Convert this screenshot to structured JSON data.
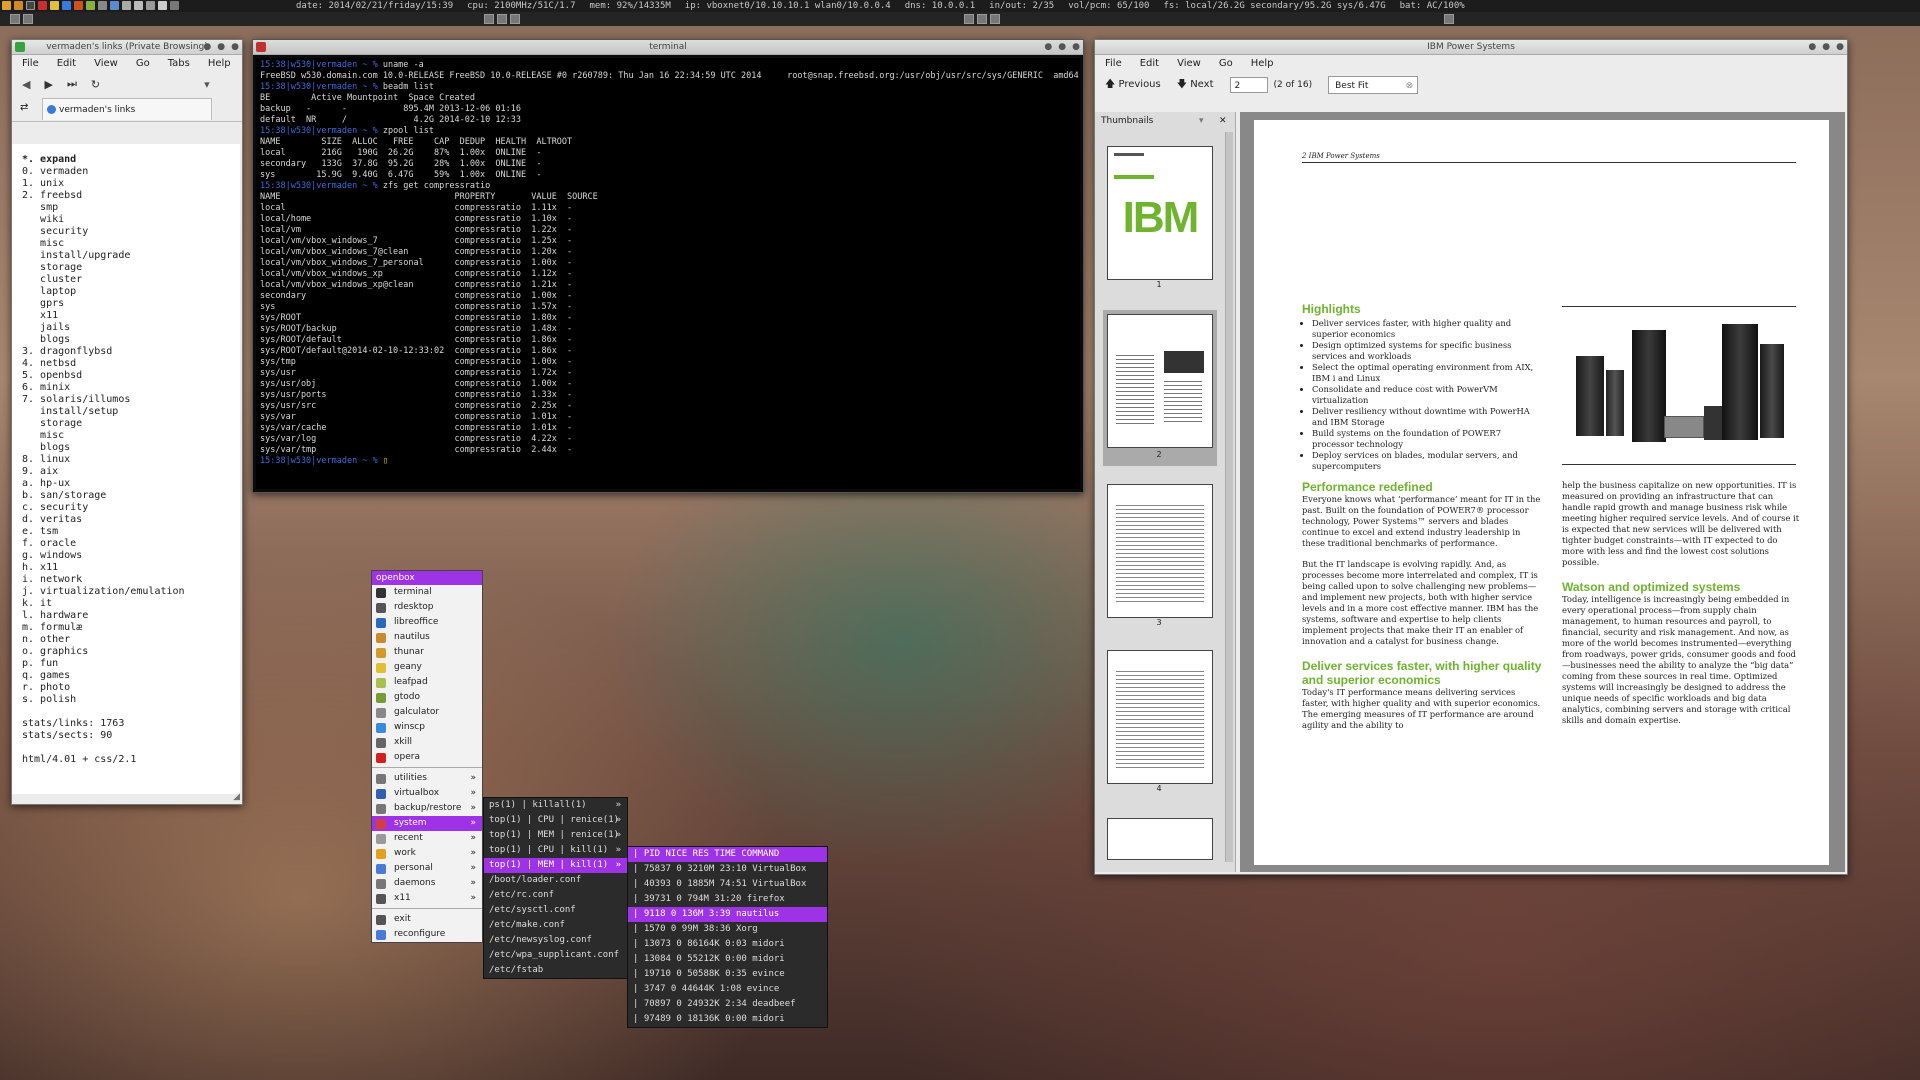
{
  "topbar": {
    "date": "date: 2014/02/21/friday/15:39",
    "cpu": "cpu: 2100MHz/51C/1.7",
    "mem": "mem: 92%/14335M",
    "ip": "ip: vboxnet0/10.10.10.1 wlan0/10.0.0.4",
    "dns": "dns: 10.0.0.1",
    "inout": "in/out: 2/35",
    "vol": "vol/pcm: 65/100",
    "fs": "fs: local/26.2G secondary/95.2G sys/6.47G",
    "bat": "bat: AC/100%"
  },
  "links_window": {
    "title": "vermaden's links (Private Browsing)",
    "menu": [
      "File",
      "Edit",
      "View",
      "Go",
      "Tabs",
      "Help"
    ],
    "tab_label": "vermaden's links",
    "lines": [
      "*. expand",
      "0. vermaden",
      "1. unix",
      "2. freebsd",
      "   smp",
      "   wiki",
      "   security",
      "   misc",
      "   install/upgrade",
      "   storage",
      "   cluster",
      "   laptop",
      "   gprs",
      "   x11",
      "   jails",
      "   blogs",
      "3. dragonflybsd",
      "4. netbsd",
      "5. openbsd",
      "6. minix",
      "7. solaris/illumos",
      "   install/setup",
      "   storage",
      "   misc",
      "   blogs",
      "8. linux",
      "9. aix",
      "a. hp-ux",
      "b. san/storage",
      "c. security",
      "d. veritas",
      "e. tsm",
      "f. oracle",
      "g. windows",
      "h. x11",
      "i. network",
      "j. virtualization/emulation",
      "k. it",
      "l. hardware",
      "m. formulæ",
      "n. other",
      "o. graphics",
      "p. fun",
      "q. games",
      "r. photo",
      "s. polish",
      "",
      "stats/links: 1763",
      "stats/sects: 90",
      "",
      "html/4.01 + css/2.1"
    ]
  },
  "terminal": {
    "title": "terminal",
    "lines": [
      {
        "p": "15:38|w530|vermaden ~ % ",
        "t": "uname -a"
      },
      {
        "p": "",
        "t": "FreeBSD w530.domain.com 10.0-RELEASE FreeBSD 10.0-RELEASE #0 r260789: Thu Jan 16 22:34:59 UTC 2014     root@snap.freebsd.org:/usr/obj/usr/src/sys/GENERIC  amd64"
      },
      {
        "p": "15:38|w530|vermaden ~ % ",
        "t": "beadm list"
      },
      {
        "p": "",
        "t": "BE        Active Mountpoint  Space Created"
      },
      {
        "p": "",
        "t": "backup   -      -           895.4M 2013-12-06 01:16"
      },
      {
        "p": "",
        "t": "default  NR     /             4.2G 2014-02-10 12:33"
      },
      {
        "p": "15:38|w530|vermaden ~ % ",
        "t": "zpool list"
      },
      {
        "p": "",
        "t": "NAME        SIZE  ALLOC   FREE    CAP  DEDUP  HEALTH  ALTROOT"
      },
      {
        "p": "",
        "t": "local       216G   190G  26.2G    87%  1.00x  ONLINE  -"
      },
      {
        "p": "",
        "t": "secondary   133G  37.8G  95.2G    28%  1.00x  ONLINE  -"
      },
      {
        "p": "",
        "t": "sys        15.9G  9.40G  6.47G    59%  1.00x  ONLINE  -"
      },
      {
        "p": "15:38|w530|vermaden ~ % ",
        "t": "zfs get compressratio"
      },
      {
        "p": "",
        "t": "NAME                                  PROPERTY       VALUE  SOURCE"
      },
      {
        "p": "",
        "t": "local                                 compressratio  1.11x  -"
      },
      {
        "p": "",
        "t": "local/home                            compressratio  1.10x  -"
      },
      {
        "p": "",
        "t": "local/vm                              compressratio  1.22x  -"
      },
      {
        "p": "",
        "t": "local/vm/vbox_windows_7               compressratio  1.25x  -"
      },
      {
        "p": "",
        "t": "local/vm/vbox_windows_7@clean         compressratio  1.20x  -"
      },
      {
        "p": "",
        "t": "local/vm/vbox_windows_7_personal      compressratio  1.00x  -"
      },
      {
        "p": "",
        "t": "local/vm/vbox_windows_xp              compressratio  1.12x  -"
      },
      {
        "p": "",
        "t": "local/vm/vbox_windows_xp@clean        compressratio  1.21x  -"
      },
      {
        "p": "",
        "t": "secondary                             compressratio  1.00x  -"
      },
      {
        "p": "",
        "t": "sys                                   compressratio  1.57x  -"
      },
      {
        "p": "",
        "t": "sys/ROOT                              compressratio  1.80x  -"
      },
      {
        "p": "",
        "t": "sys/ROOT/backup                       compressratio  1.48x  -"
      },
      {
        "p": "",
        "t": "sys/ROOT/default                      compressratio  1.86x  -"
      },
      {
        "p": "",
        "t": "sys/ROOT/default@2014-02-10-12:33:02  compressratio  1.86x  -"
      },
      {
        "p": "",
        "t": "sys/tmp                               compressratio  1.00x  -"
      },
      {
        "p": "",
        "t": "sys/usr                               compressratio  1.72x  -"
      },
      {
        "p": "",
        "t": "sys/usr/obj                           compressratio  1.00x  -"
      },
      {
        "p": "",
        "t": "sys/usr/ports                         compressratio  1.33x  -"
      },
      {
        "p": "",
        "t": "sys/usr/src                           compressratio  2.25x  -"
      },
      {
        "p": "",
        "t": "sys/var                               compressratio  1.01x  -"
      },
      {
        "p": "",
        "t": "sys/var/cache                         compressratio  1.01x  -"
      },
      {
        "p": "",
        "t": "sys/var/log                           compressratio  4.22x  -"
      },
      {
        "p": "",
        "t": "sys/var/tmp                           compressratio  2.44x  -"
      },
      {
        "p": "15:38|w530|vermaden ~ % ",
        "t": "▯"
      }
    ]
  },
  "pdf_window": {
    "title": "IBM Power Systems",
    "menu": [
      "File",
      "Edit",
      "View",
      "Go",
      "Help"
    ],
    "prev_label": "Previous",
    "next_label": "Next",
    "page_value": "2",
    "page_count": "(2 of 16)",
    "zoom": "Best Fit",
    "sidebar_title": "Thumbnails",
    "thumb_nums": [
      "1",
      "2",
      "3",
      "4"
    ],
    "header": "2   IBM Power Systems",
    "h_highlights": "Highlights",
    "highlights": [
      "Deliver services faster, with higher quality and superior economics",
      "Design optimized systems for specific business services and workloads",
      "Select the optimal operating environment from AIX, IBM i and Linux",
      "Consolidate and reduce cost with PowerVM virtualization",
      "Deliver resiliency without downtime with PowerHA and IBM Storage",
      "Build systems on the foundation of POWER7 processor technology",
      "Deploy services on blades, modular servers, and supercomputers"
    ],
    "h_perf": "Performance redefined",
    "p_perf1": "Everyone knows what ‘performance’ meant for IT in the past. Built on the foundation of POWER7® processor technology, Power Systems™ servers and blades continue to excel and extend industry leadership in these traditional benchmarks of performance.",
    "p_perf2": "But the IT landscape is evolving rapidly. And, as processes become more interrelated and complex, IT is being called upon to solve challenging new problems—and implement new projects, both with higher service levels and in a more cost effective manner. IBM has the systems, software and expertise to help clients implement projects that make their IT an enabler of innovation and a catalyst for business change.",
    "h_deliver": "Deliver services faster, with higher quality and superior economics",
    "p_deliver": "Today's IT performance means delivering services faster, with higher quality and with superior economics. The emerging measures of IT performance are around agility and the ability to",
    "p_right1": "help the business capitalize on new opportunities. IT is measured on providing an infrastructure that can handle rapid growth and manage business risk while meeting higher required service levels. And of course it is expected that new services will be delivered with tighter budget constraints—with IT expected to do more with less and find the lowest cost solutions possible.",
    "h_watson": "Watson and optimized systems",
    "p_watson": "Today, intelligence is increasingly being embedded in every operational process—from supply chain management, to human resources and payroll, to financial, security and risk management. And now, as more of the world becomes instrumented—everything from roadways, power grids, consumer goods and food—businesses need the ability to analyze the “big data” coming from these sources in real time. Optimized systems will increasingly be designed to address the unique needs of specific workloads and big data analytics, combining servers and storage with critical skills and domain expertise.",
    "thumb_logo": "IBM"
  },
  "openbox_menu": {
    "title": "openbox",
    "items": [
      {
        "label": "terminal",
        "color": "#333"
      },
      {
        "label": "rdesktop",
        "color": "#555"
      },
      {
        "label": "libreoffice",
        "color": "#2a6ab8"
      },
      {
        "label": "nautilus",
        "color": "#c88a2e"
      },
      {
        "label": "thunar",
        "color": "#d49a2a"
      },
      {
        "label": "geany",
        "color": "#e0c030"
      },
      {
        "label": "leafpad",
        "color": "#a8c050"
      },
      {
        "label": "gtodo",
        "color": "#7a9a3a"
      },
      {
        "label": "galculator",
        "color": "#888"
      },
      {
        "label": "winscp",
        "color": "#3a8ad8"
      },
      {
        "label": "xkill",
        "color": "#666"
      },
      {
        "label": "opera",
        "color": "#d32020"
      }
    ],
    "submenus": [
      {
        "label": "utilities",
        "color": "#777",
        "sel": false
      },
      {
        "label": "virtualbox",
        "color": "#3060b0",
        "sel": false
      },
      {
        "label": "backup/restore",
        "color": "#777",
        "sel": false
      },
      {
        "label": "system",
        "color": "#d04040",
        "sel": true
      },
      {
        "label": "recent",
        "color": "#999",
        "sel": false
      },
      {
        "label": "work",
        "color": "#e0a020",
        "sel": false
      },
      {
        "label": "personal",
        "color": "#4a7ad8",
        "sel": false
      },
      {
        "label": "daemons",
        "color": "#777",
        "sel": false
      },
      {
        "label": "x11",
        "color": "#555",
        "sel": false
      }
    ],
    "exit_label": "exit",
    "reconfigure_label": "reconfigure"
  },
  "system_menu": {
    "items": [
      {
        "label": "ps(1) | killall(1)",
        "sel": false
      },
      {
        "label": "top(1) | CPU | renice(1)",
        "sel": false
      },
      {
        "label": "top(1) | MEM | renice(1)",
        "sel": false
      },
      {
        "label": "top(1) | CPU | kill(1)",
        "sel": false
      },
      {
        "label": "top(1) | MEM | kill(1)",
        "sel": true
      }
    ],
    "files": [
      "/boot/loader.conf",
      "/etc/rc.conf",
      "/etc/sysctl.conf",
      "/etc/make.conf",
      "/etc/newsyslog.conf",
      "/etc/wpa_supplicant.conf",
      "/etc/fstab"
    ]
  },
  "process_menu": {
    "header": "PID NICE   RES  TIME COMMAND",
    "rows": [
      {
        "text": "75837    0  3210M 23:10 VirtualBox",
        "sel": false
      },
      {
        "text": "40393    0  1885M 74:51 VirtualBox",
        "sel": false
      },
      {
        "text": "39731    0   794M 31:20 firefox",
        "sel": false
      },
      {
        "text": "9118     0   136M  3:39 nautilus",
        "sel": true
      },
      {
        "text": "1570     0    99M 38:36 Xorg",
        "sel": false
      },
      {
        "text": "13073    0 86164K  0:03 midori",
        "sel": false
      },
      {
        "text": "13084    0 55212K  0:00 midori",
        "sel": false
      },
      {
        "text": "19710    0 50588K  0:35 evince",
        "sel": false
      },
      {
        "text": "3747     0 44644K  1:08 evince",
        "sel": false
      },
      {
        "text": "70897    0 24932K  2:34 deadbeef",
        "sel": false
      },
      {
        "text": "97489    0 18136K  0:00 midori",
        "sel": false
      }
    ]
  },
  "colors": {
    "accent": "#9e32e6",
    "pdf_green": "#6fb32f",
    "prompt": "#3f6ad8"
  }
}
